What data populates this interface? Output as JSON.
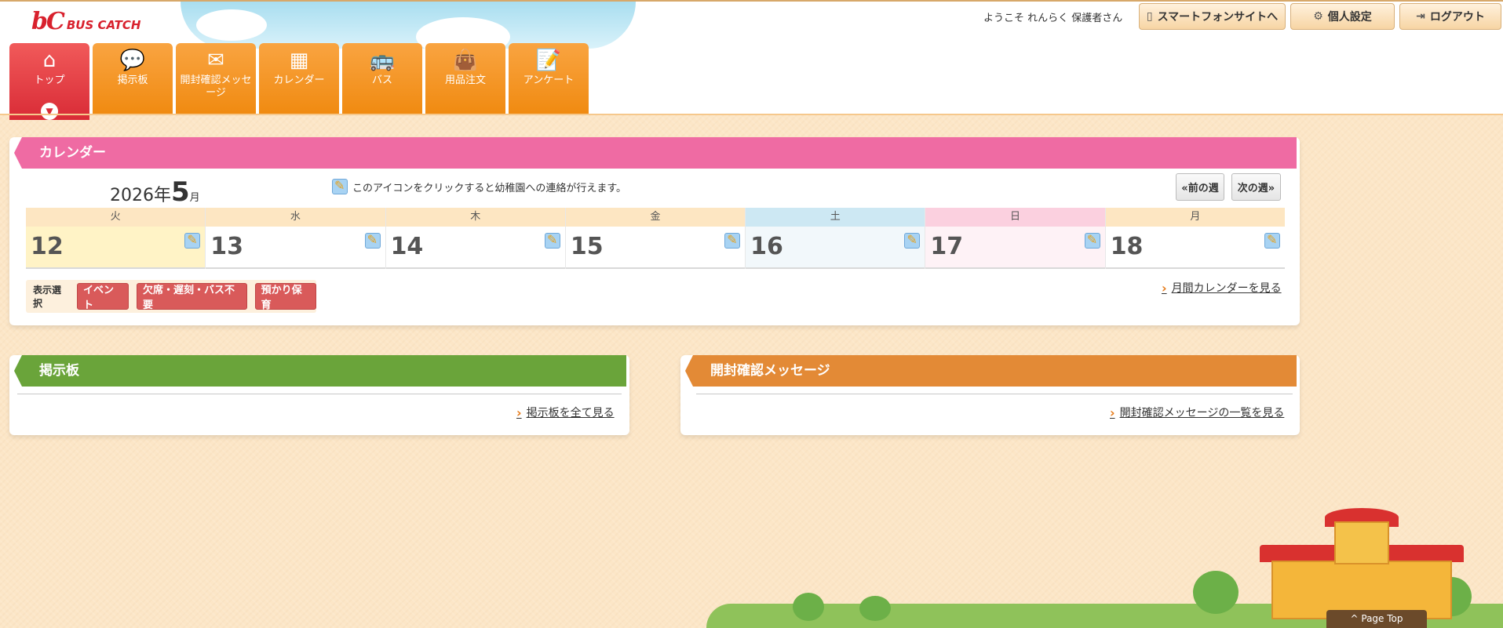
{
  "brand": {
    "mark": "bC",
    "name": "BUS CATCH"
  },
  "welcome": "ようこそ れんらく 保護者さん",
  "top_buttons": {
    "smartphone": "スマートフォンサイトへ",
    "settings": "個人設定",
    "logout": "ログアウト"
  },
  "nav": {
    "top": "トップ",
    "board": "掲示板",
    "read_confirm": "開封確認メッセージ",
    "calendar": "カレンダー",
    "bus": "バス",
    "supplies": "用品注文",
    "survey": "アンケート"
  },
  "calendar": {
    "title": "カレンダー",
    "year": "2026年",
    "month": "5",
    "month_unit": "月",
    "hint": "このアイコンをクリックすると幼稚園への連絡が行えます。",
    "prev_week": "«前の週",
    "next_week": "次の週»",
    "days": [
      {
        "dow": "火",
        "date": "12"
      },
      {
        "dow": "水",
        "date": "13"
      },
      {
        "dow": "木",
        "date": "14"
      },
      {
        "dow": "金",
        "date": "15"
      },
      {
        "dow": "土",
        "date": "16"
      },
      {
        "dow": "日",
        "date": "17"
      },
      {
        "dow": "月",
        "date": "18"
      }
    ],
    "filter_label": "表示選択",
    "filter_event": "イベント",
    "filter_absence": "欠席・遅刻・バス不要",
    "filter_care": "預かり保育",
    "monthly_link": "月間カレンダーを見る"
  },
  "board": {
    "title": "掲示板",
    "link": "掲示板を全て見る"
  },
  "read_confirm": {
    "title": "開封確認メッセージ",
    "link": "開封確認メッセージの一覧を見る"
  },
  "page_top": "Page Top"
}
